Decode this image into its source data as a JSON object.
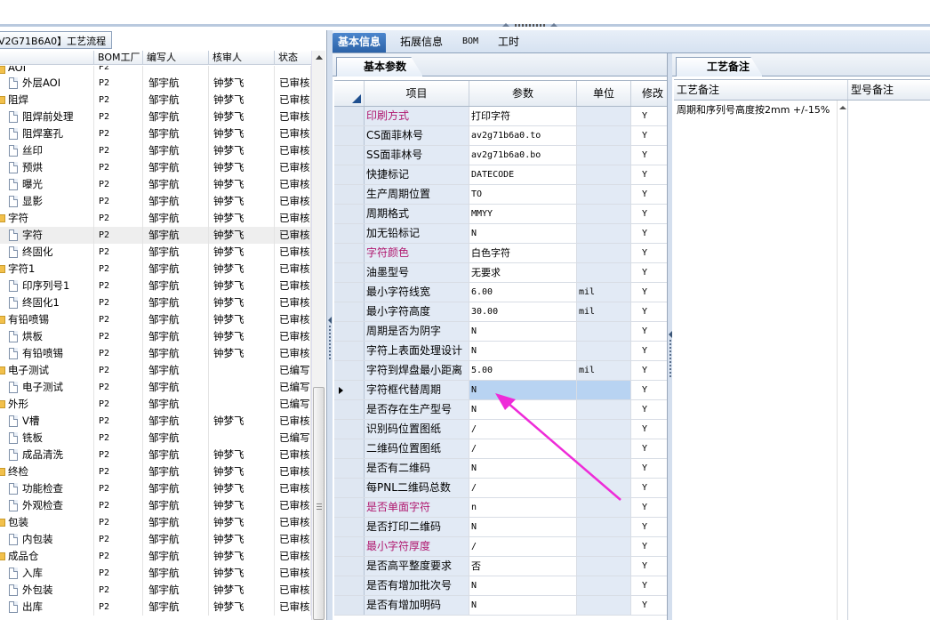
{
  "left_pane": {
    "tab_title": "V2G71B6A0】工艺流程",
    "columns": [
      "",
      "BOM工厂",
      "编写人",
      "核审人",
      "状态"
    ],
    "rows": [
      {
        "name": "AOI",
        "bom": "P2",
        "editor": "",
        "reviewer": "",
        "status": "",
        "level": 1,
        "partial": true
      },
      {
        "name": "外层AOI",
        "bom": "P2",
        "editor": "邹宇航",
        "reviewer": "钟梦飞",
        "status": "已审核",
        "level": 2
      },
      {
        "name": "阻焊",
        "bom": "P2",
        "editor": "邹宇航",
        "reviewer": "钟梦飞",
        "status": "已审核",
        "level": 1
      },
      {
        "name": "阻焊前处理",
        "bom": "P2",
        "editor": "邹宇航",
        "reviewer": "钟梦飞",
        "status": "已审核",
        "level": 2
      },
      {
        "name": "阻焊塞孔",
        "bom": "P2",
        "editor": "邹宇航",
        "reviewer": "钟梦飞",
        "status": "已审核",
        "level": 2
      },
      {
        "name": "丝印",
        "bom": "P2",
        "editor": "邹宇航",
        "reviewer": "钟梦飞",
        "status": "已审核",
        "level": 2
      },
      {
        "name": "预烘",
        "bom": "P2",
        "editor": "邹宇航",
        "reviewer": "钟梦飞",
        "status": "已审核",
        "level": 2
      },
      {
        "name": "曝光",
        "bom": "P2",
        "editor": "邹宇航",
        "reviewer": "钟梦飞",
        "status": "已审核",
        "level": 2
      },
      {
        "name": "显影",
        "bom": "P2",
        "editor": "邹宇航",
        "reviewer": "钟梦飞",
        "status": "已审核",
        "level": 2
      },
      {
        "name": "字符",
        "bom": "P2",
        "editor": "邹宇航",
        "reviewer": "钟梦飞",
        "status": "已审核",
        "level": 1
      },
      {
        "name": "字符",
        "bom": "P2",
        "editor": "邹宇航",
        "reviewer": "钟梦飞",
        "status": "已审核",
        "level": 2,
        "selected": true
      },
      {
        "name": "终固化",
        "bom": "P2",
        "editor": "邹宇航",
        "reviewer": "钟梦飞",
        "status": "已审核",
        "level": 2
      },
      {
        "name": "字符1",
        "bom": "P2",
        "editor": "邹宇航",
        "reviewer": "钟梦飞",
        "status": "已审核",
        "level": 1
      },
      {
        "name": "印序列号1",
        "bom": "P2",
        "editor": "邹宇航",
        "reviewer": "钟梦飞",
        "status": "已审核",
        "level": 2
      },
      {
        "name": "终固化1",
        "bom": "P2",
        "editor": "邹宇航",
        "reviewer": "钟梦飞",
        "status": "已审核",
        "level": 2
      },
      {
        "name": "有铅喷锡",
        "bom": "P2",
        "editor": "邹宇航",
        "reviewer": "钟梦飞",
        "status": "已审核",
        "level": 1
      },
      {
        "name": "烘板",
        "bom": "P2",
        "editor": "邹宇航",
        "reviewer": "钟梦飞",
        "status": "已审核",
        "level": 2
      },
      {
        "name": "有铅喷锡",
        "bom": "P2",
        "editor": "邹宇航",
        "reviewer": "钟梦飞",
        "status": "已审核",
        "level": 2
      },
      {
        "name": "电子测试",
        "bom": "P2",
        "editor": "邹宇航",
        "reviewer": "",
        "status": "已编写",
        "level": 1
      },
      {
        "name": "电子测试",
        "bom": "P2",
        "editor": "邹宇航",
        "reviewer": "",
        "status": "已编写",
        "level": 2
      },
      {
        "name": "外形",
        "bom": "P2",
        "editor": "邹宇航",
        "reviewer": "",
        "status": "已编写",
        "level": 1
      },
      {
        "name": "V槽",
        "bom": "P2",
        "editor": "邹宇航",
        "reviewer": "钟梦飞",
        "status": "已审核",
        "level": 2
      },
      {
        "name": "铣板",
        "bom": "P2",
        "editor": "邹宇航",
        "reviewer": "",
        "status": "已编写",
        "level": 2
      },
      {
        "name": "成品清洗",
        "bom": "P2",
        "editor": "邹宇航",
        "reviewer": "钟梦飞",
        "status": "已审核",
        "level": 2
      },
      {
        "name": "终检",
        "bom": "P2",
        "editor": "邹宇航",
        "reviewer": "钟梦飞",
        "status": "已审核",
        "level": 1
      },
      {
        "name": "功能检查",
        "bom": "P2",
        "editor": "邹宇航",
        "reviewer": "钟梦飞",
        "status": "已审核",
        "level": 2
      },
      {
        "name": "外观检查",
        "bom": "P2",
        "editor": "邹宇航",
        "reviewer": "钟梦飞",
        "status": "已审核",
        "level": 2
      },
      {
        "name": "包装",
        "bom": "P2",
        "editor": "邹宇航",
        "reviewer": "钟梦飞",
        "status": "已审核",
        "level": 1
      },
      {
        "name": "内包装",
        "bom": "P2",
        "editor": "邹宇航",
        "reviewer": "钟梦飞",
        "status": "已审核",
        "level": 2
      },
      {
        "name": "成品仓",
        "bom": "P2",
        "editor": "邹宇航",
        "reviewer": "钟梦飞",
        "status": "已审核",
        "level": 1
      },
      {
        "name": "入库",
        "bom": "P2",
        "editor": "邹宇航",
        "reviewer": "钟梦飞",
        "status": "已审核",
        "level": 2
      },
      {
        "name": "外包装",
        "bom": "P2",
        "editor": "邹宇航",
        "reviewer": "钟梦飞",
        "status": "已审核",
        "level": 2
      },
      {
        "name": "出库",
        "bom": "P2",
        "editor": "邹宇航",
        "reviewer": "钟梦飞",
        "status": "已审核",
        "level": 2
      }
    ]
  },
  "main_tabs": [
    "基本信息",
    "拓展信息",
    "BOM",
    "工时"
  ],
  "params_panel": {
    "tab_title": "基本参数",
    "columns": [
      "项目",
      "参数",
      "单位",
      "修改"
    ],
    "rows": [
      {
        "item": "印刷方式",
        "param": "打印字符",
        "unit": "",
        "mod": "Y",
        "pink": true
      },
      {
        "item": "CS面菲林号",
        "param": "av2g71b6a0.to",
        "unit": "",
        "mod": "Y",
        "mono": true
      },
      {
        "item": "SS面菲林号",
        "param": "av2g71b6a0.bo",
        "unit": "",
        "mod": "Y",
        "mono": true
      },
      {
        "item": "快捷标记",
        "param": "DATECODE",
        "unit": "",
        "mod": "Y",
        "mono": true
      },
      {
        "item": "生产周期位置",
        "param": "TO",
        "unit": "",
        "mod": "Y",
        "mono": true
      },
      {
        "item": "周期格式",
        "param": "MMYY",
        "unit": "",
        "mod": "Y",
        "mono": true
      },
      {
        "item": "加无铅标记",
        "param": "N",
        "unit": "",
        "mod": "Y",
        "mono": true
      },
      {
        "item": "字符颜色",
        "param": "白色字符",
        "unit": "",
        "mod": "Y",
        "pink": true
      },
      {
        "item": "油墨型号",
        "param": "无要求",
        "unit": "",
        "mod": "Y"
      },
      {
        "item": "最小字符线宽",
        "param": "6.00",
        "unit": "mil",
        "mod": "Y",
        "mono": true
      },
      {
        "item": "最小字符高度",
        "param": "30.00",
        "unit": "mil",
        "mod": "Y",
        "mono": true
      },
      {
        "item": "周期是否为阴字",
        "param": "N",
        "unit": "",
        "mod": "Y",
        "mono": true
      },
      {
        "item": "字符上表面处理设计",
        "param": "N",
        "unit": "",
        "mod": "Y",
        "mono": true
      },
      {
        "item": "字符到焊盘最小距离",
        "param": "5.00",
        "unit": "mil",
        "mod": "Y",
        "mono": true
      },
      {
        "item": "字符框代替周期",
        "param": "N",
        "unit": "",
        "mod": "Y",
        "mono": true,
        "current": true
      },
      {
        "item": "是否存在生产型号",
        "param": "N",
        "unit": "",
        "mod": "Y",
        "mono": true
      },
      {
        "item": "识别码位置图纸",
        "param": "/",
        "unit": "",
        "mod": "Y",
        "mono": true
      },
      {
        "item": "二维码位置图纸",
        "param": "/",
        "unit": "",
        "mod": "Y",
        "mono": true
      },
      {
        "item": "是否有二维码",
        "param": "N",
        "unit": "",
        "mod": "Y",
        "mono": true
      },
      {
        "item": "每PNL二维码总数",
        "param": "/",
        "unit": "",
        "mod": "Y",
        "mono": true
      },
      {
        "item": "是否单面字符",
        "param": "n",
        "unit": "",
        "mod": "Y",
        "mono": true,
        "pink": true
      },
      {
        "item": "是否打印二维码",
        "param": "N",
        "unit": "",
        "mod": "Y",
        "mono": true
      },
      {
        "item": "最小字符厚度",
        "param": "/",
        "unit": "",
        "mod": "Y",
        "mono": true,
        "pink": true
      },
      {
        "item": "是否高平整度要求",
        "param": "否",
        "unit": "",
        "mod": "Y"
      },
      {
        "item": "是否有增加批次号",
        "param": "N",
        "unit": "",
        "mod": "Y",
        "mono": true
      },
      {
        "item": "是否有增加明码",
        "param": "N",
        "unit": "",
        "mod": "Y",
        "mono": true
      }
    ]
  },
  "notes_panel": {
    "tab_title": "工艺备注",
    "columns": [
      "工艺备注",
      "型号备注"
    ],
    "note_text": "周期和序列号高度按2mm +/-15%"
  },
  "colors": {
    "accent": "#2c63a8",
    "pink_label": "#b0186f",
    "selection": "#b8d3f2",
    "annotation_arrow": "#ee2bd8"
  }
}
